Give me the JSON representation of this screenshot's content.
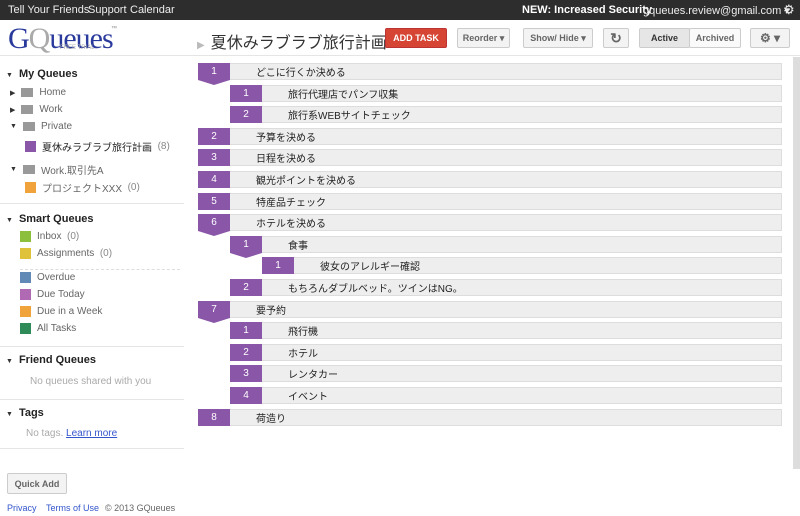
{
  "topbar": {
    "links": [
      "Tell Your Friends",
      "Support",
      "Calendar"
    ],
    "news": "NEW: Increased Security",
    "account": "gqueues.review@gmail.com ▾"
  },
  "logo": {
    "text_g": "G",
    "text_q": "Q",
    "text_rest": "ueues",
    "tm": "™",
    "trial": "FREE TRIAL"
  },
  "header": {
    "title": "夏休みラブラブ旅行計画",
    "add_task": "ADD TASK",
    "reorder": "Reorder ▾",
    "show_hide": "Show/ Hide ▾",
    "refresh": "↻",
    "active": "Active",
    "archived": "Archived",
    "settings": "⚙ ▾"
  },
  "sidebar": {
    "my_queues": "My Queues",
    "folders": [
      {
        "label": "Home"
      },
      {
        "label": "Work"
      },
      {
        "label": "Private"
      }
    ],
    "queue1": {
      "label": "夏休みラブラブ旅行計画",
      "count": "(8)",
      "color": "#8a56a8"
    },
    "folder4": "Work.取引先A",
    "queue2": {
      "label": "プロジェクトXXX",
      "count": "(0)",
      "color": "#f0a33a"
    },
    "smart_queues": "Smart Queues",
    "smart": [
      {
        "label": "Inbox",
        "count": "(0)",
        "color": "#8cbf3c"
      },
      {
        "label": "Assignments",
        "count": "(0)",
        "color": "#e0c13a"
      },
      {
        "label": "Overdue",
        "count": "",
        "color": "#6089b5"
      },
      {
        "label": "Due Today",
        "count": "",
        "color": "#b06ab3"
      },
      {
        "label": "Due in a Week",
        "count": "",
        "color": "#f0a33a"
      },
      {
        "label": "All Tasks",
        "count": "",
        "color": "#2e8b57"
      }
    ],
    "friend_queues": "Friend Queues",
    "friend_empty": "No queues shared with you",
    "tags": "Tags",
    "tags_empty": "No tags.",
    "learn_more": "Learn more",
    "quick_add": "Quick Add"
  },
  "footer": {
    "privacy": "Privacy",
    "terms": "Terms of Use",
    "copyright": "© 2013 GQueues"
  },
  "tasks": [
    {
      "num": "1",
      "text": "どこに行くか決める",
      "level": 0,
      "parent": true
    },
    {
      "num": "1",
      "text": "旅行代理店でパンフ収集",
      "level": 1
    },
    {
      "num": "2",
      "text": "旅行系WEBサイトチェック",
      "level": 1
    },
    {
      "num": "2",
      "text": "予算を決める",
      "level": 0
    },
    {
      "num": "3",
      "text": "日程を決める",
      "level": 0
    },
    {
      "num": "4",
      "text": "観光ポイントを決める",
      "level": 0
    },
    {
      "num": "5",
      "text": "特産品チェック",
      "level": 0
    },
    {
      "num": "6",
      "text": "ホテルを決める",
      "level": 0,
      "parent": true
    },
    {
      "num": "1",
      "text": "食事",
      "level": 1,
      "parent": true
    },
    {
      "num": "1",
      "text": "彼女のアレルギー確認",
      "level": 2
    },
    {
      "num": "2",
      "text": "もちろんダブルベッド。ツインはNG。",
      "level": 1
    },
    {
      "num": "7",
      "text": "要予約",
      "level": 0,
      "parent": true
    },
    {
      "num": "1",
      "text": "飛行機",
      "level": 1
    },
    {
      "num": "2",
      "text": "ホテル",
      "level": 1
    },
    {
      "num": "3",
      "text": "レンタカー",
      "level": 1
    },
    {
      "num": "4",
      "text": "イベント",
      "level": 1
    },
    {
      "num": "8",
      "text": "荷造り",
      "level": 0
    }
  ]
}
